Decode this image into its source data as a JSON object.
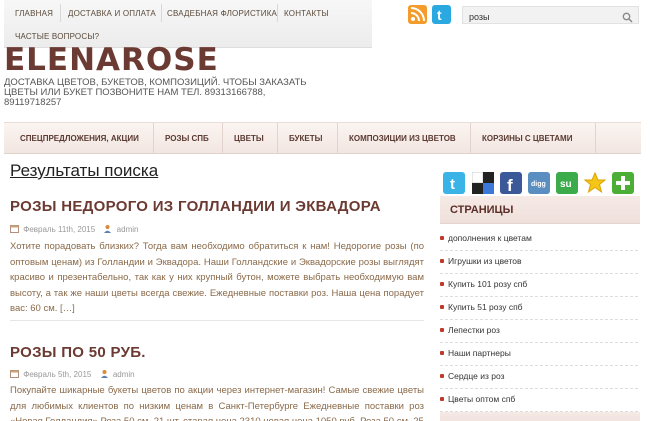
{
  "top_nav": {
    "items": [
      "ГЛАВНАЯ",
      "ДОСТАВКА И ОПЛАТА",
      "СВАДЕБНАЯ ФЛОРИСТИКА",
      "КОНТАКТЫ"
    ],
    "second_row": "ЧАСТЫЕ ВОПРОСЫ?"
  },
  "search": {
    "value": "розы"
  },
  "header": {
    "logo": "ELENAROSE",
    "description": "ДОСТАВКА ЦВЕТОВ, БУКЕТОВ, КОМПОЗИЦИЙ. ЧТОБЫ ЗАКАЗАТЬ ЦВЕТЫ ИЛИ БУКЕТ ПОЗВОНИТЕ НАМ тел. 89313166788, 89119718257"
  },
  "main_nav": {
    "items": [
      "СПЕЦПРЕДЛОЖЕНИЯ, АКЦИИ",
      "РОЗЫ СПБ",
      "ЦВЕТЫ",
      "БУКЕТЫ",
      "КОМПОЗИЦИИ ИЗ ЦВЕТОВ",
      "КОРЗИНЫ С ЦВЕТАМИ"
    ]
  },
  "content": {
    "results_title": "Результаты поиска",
    "posts": [
      {
        "title": "РОЗЫ НЕДОРОГО ИЗ ГОЛЛАНДИИ И ЭКВАДОРА",
        "date": "Февраль 11th, 2015",
        "author": "admin",
        "excerpt": "Хотите порадовать близких? Тогда вам необходимо обратиться к нам!  Недорогие розы (по оптовым ценам) из Голландии и Эквадора. Наши Голландские и Эквадорские розы выглядят красиво и презентабельно, так как у них крупный бутон, можете выбрать необходимую вам высоту, а так же наши цветы всегда свежие. Ежедневные поставки роз. Наша цена порадует вас: 60 см. […]"
      },
      {
        "title": "РОЗЫ ПО 50 РУБ.",
        "date": "Февраль 5th, 2015",
        "author": "admin",
        "excerpt": "Покупайте шикарные букеты цветов по акции через интернет-магазин! Самые свежие цветы для любимых клиентов по низким ценам в Санкт-Петербурге Ежедневные поставки роз «Новая Голландия» Роза 50 см. 21 шт. старая цена 2310 новая цена 1050 руб. Роза 50 см. 25"
      }
    ]
  },
  "sidebar": {
    "share_icons": [
      "twitter-icon",
      "delicious-icon",
      "facebook-icon",
      "digg-icon",
      "stumbleupon-icon",
      "favorite-star-icon",
      "add-plus-icon"
    ],
    "pages_title": "СТРАНИЦЫ",
    "pages": [
      "дополнения к цветам",
      "Игрушки из цветов",
      "Купить 101 розу спб",
      "Купить 51 розу спб",
      "Лепестки роз",
      "Наши партнеры",
      "Сердце из роз",
      "Цветы оптом спб"
    ]
  },
  "colors": {
    "accent": "#6b3a32",
    "excerpt_text": "#8a6a4a",
    "bullet": "#c0392b"
  }
}
